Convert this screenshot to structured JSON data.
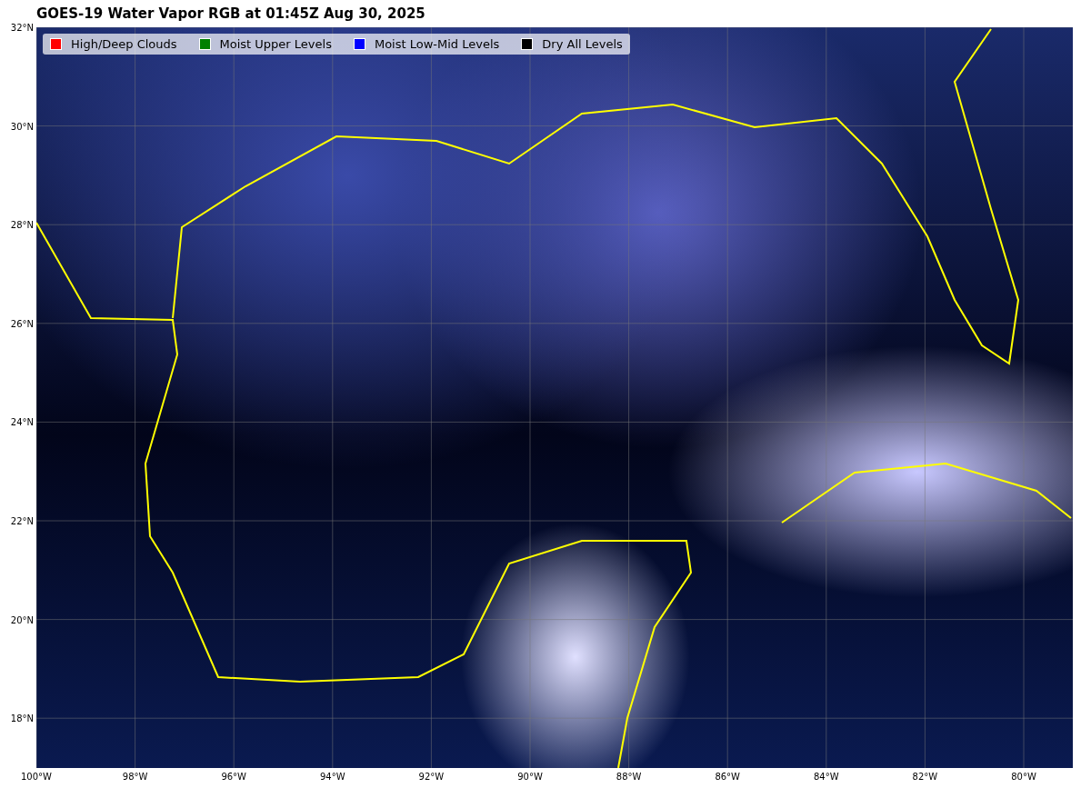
{
  "title": "GOES-19 Water Vapor RGB at 01:45Z Aug 30, 2025",
  "legend": [
    {
      "label": "High/Deep Clouds",
      "color": "#ff0000"
    },
    {
      "label": "Moist Upper Levels",
      "color": "#008000"
    },
    {
      "label": "Moist Low-Mid Levels",
      "color": "#0000ff"
    },
    {
      "label": "Dry All Levels",
      "color": "#000000"
    }
  ],
  "y_axis_labels": [
    "32°N",
    "30°N",
    "28°N",
    "26°N",
    "24°N",
    "22°N",
    "20°N",
    "18°N"
  ],
  "x_axis_labels": [
    "100°W",
    "98°W",
    "96°W",
    "94°W",
    "92°W",
    "90°W",
    "88°W",
    "86°W",
    "84°W",
    "82°W",
    "80°W"
  ]
}
